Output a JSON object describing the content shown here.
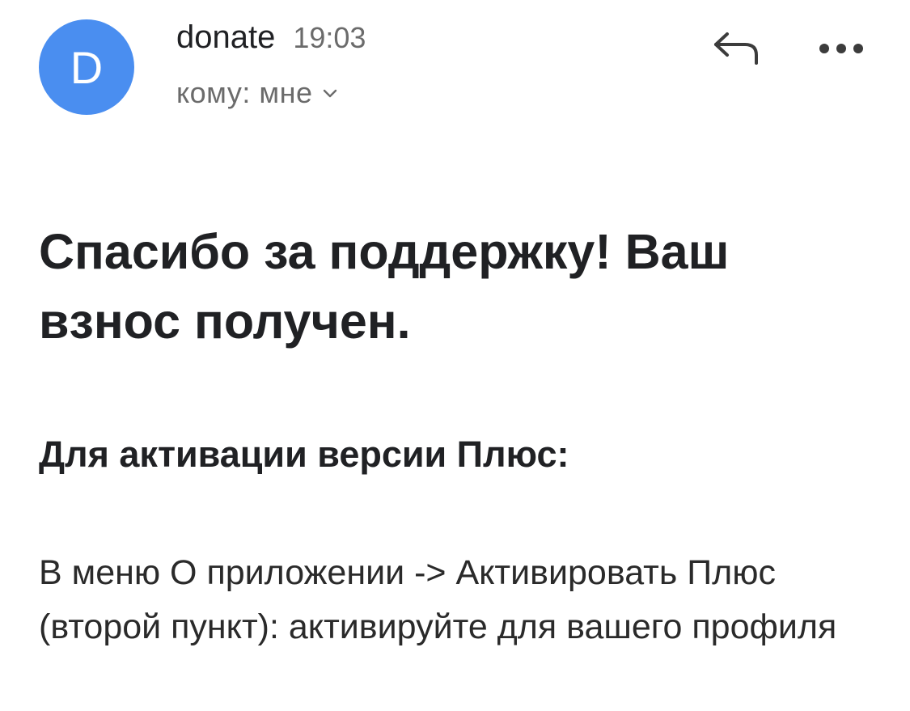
{
  "header": {
    "avatar_letter": "D",
    "avatar_color": "#4a8ef0",
    "sender_name": "donate",
    "time": "19:03",
    "recipient_label": "кому: мне",
    "icons": {
      "reply": "reply-icon",
      "more": "more-horizontal-icon",
      "chevron": "chevron-down-icon"
    }
  },
  "message": {
    "heading": "Спасибо за поддержку! Ваш взнос получен.",
    "subheading": "Для активации версии Плюс:",
    "paragraph": "В меню О приложении -> Активировать Плюс (второй пункт): активируйте для вашего профиля"
  }
}
